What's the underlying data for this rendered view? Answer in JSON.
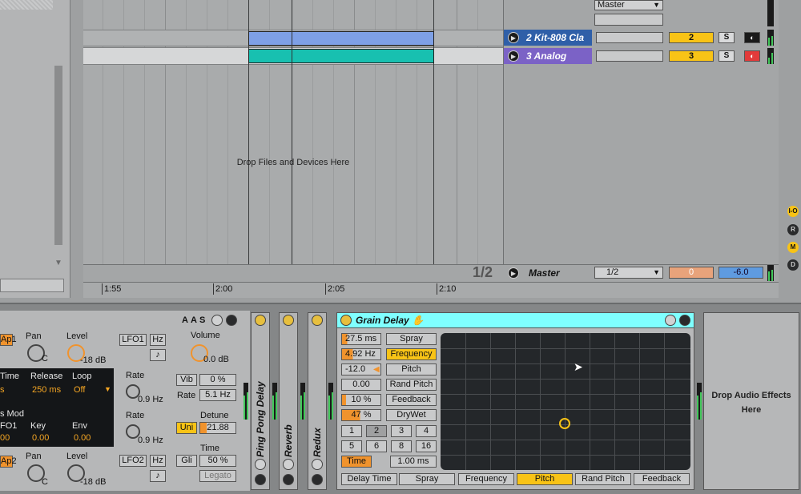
{
  "arrangement": {
    "drop_message": "Drop Files and Devices Here",
    "timeline": [
      "1:55",
      "2:00",
      "2:05",
      "2:10"
    ]
  },
  "tracks": [
    {
      "name": "2 Kit-808 Cla",
      "number": "2",
      "solo": "S",
      "color": "#2f5fa8"
    },
    {
      "name": "3 Analog",
      "number": "3",
      "solo": "S",
      "color": "#7b62c6"
    }
  ],
  "mixer": {
    "send_select": "Master"
  },
  "master": {
    "page": "1/2",
    "name": "Master",
    "quantize": "1/2",
    "volume": "0",
    "pan": "-6.0"
  },
  "side_buttons": [
    "I-O",
    "R",
    "M",
    "D"
  ],
  "synth": {
    "header_buttons": [
      "A",
      "A",
      "S"
    ],
    "pan1_label": "Pan",
    "pan1_value": "C",
    "level1_label": "Level",
    "level1_value": "-18 dB",
    "ap1_label": "Ap1",
    "time_label": "Time",
    "time_value": "s",
    "release_label": "Release",
    "release_value": "250 ms",
    "loop_label": "Loop",
    "loop_value": "Off",
    "smod_label": "s Mod",
    "lfo1_label": "FO1",
    "lfo1_value": "00",
    "key_label": "Key",
    "key_value": "0.00",
    "env_label": "Env",
    "env_value": "0.00",
    "ap2_label": "Ap2",
    "pan2_label": "Pan",
    "pan2_value": "C",
    "level2_label": "Level",
    "level2_value": "-18 dB",
    "lfo1_btn": "LFO1",
    "hz1": "Hz",
    "rate1_label": "Rate",
    "rate1_value": "0.9 Hz",
    "rate2_label": "Rate",
    "rate2_value": "0.9 Hz",
    "lfo2_btn": "LFO2",
    "hz2": "Hz",
    "note_icon": "♪",
    "volume_label": "Volume",
    "volume_value": "0.0 dB",
    "vib_btn": "Vib",
    "vib_value": "0 %",
    "rate_label": "Rate",
    "rate_value": "5.1 Hz",
    "detune_label": "Detune",
    "uni_btn": "Uni",
    "detune_value": "21.88",
    "time2_label": "Time",
    "gli_btn": "Gli",
    "gli_value": "50 %",
    "legato": "Legato"
  },
  "devices": [
    "Ping Pong Delay",
    "Reverb",
    "Redux"
  ],
  "grain_delay": {
    "title": "Grain Delay",
    "params": [
      {
        "value": "27.5 ms",
        "label": "Spray"
      },
      {
        "value": "4.92 Hz",
        "label": "Frequency"
      },
      {
        "value": "-12.0",
        "label": "Pitch"
      },
      {
        "value": "0.00",
        "label": "Rand Pitch"
      },
      {
        "value": "10 %",
        "label": "Feedback"
      },
      {
        "value": "47 %",
        "label": "DryWet"
      }
    ],
    "numbers": [
      "1",
      "2",
      "3",
      "4",
      "5",
      "6",
      "8",
      "16"
    ],
    "time_btn": "Time",
    "time_value": "1.00 ms",
    "xy_axes": [
      "Delay Time",
      "Spray",
      "Frequency",
      "Pitch",
      "Rand Pitch",
      "Feedback"
    ]
  },
  "drop_audio": "Drop Audio Effects Here"
}
